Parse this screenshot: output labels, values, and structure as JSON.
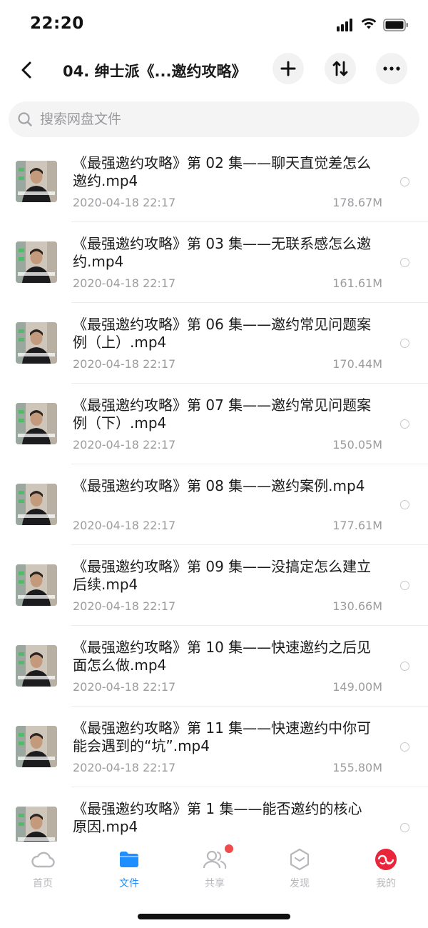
{
  "status_bar": {
    "time": "22:20"
  },
  "nav": {
    "title": "04. 绅士派《...邀约攻略》"
  },
  "search": {
    "placeholder": "搜索网盘文件"
  },
  "files": [
    {
      "name": "《最强邀约攻略》第 02 集——聊天直觉差怎么邀约.mp4",
      "date": "2020-04-18 22:17",
      "size": "178.67M"
    },
    {
      "name": "《最强邀约攻略》第 03 集——无联系感怎么邀约.mp4",
      "date": "2020-04-18 22:17",
      "size": "161.61M"
    },
    {
      "name": "《最强邀约攻略》第 06 集——邀约常见问题案例（上）.mp4",
      "date": "2020-04-18 22:17",
      "size": "170.44M"
    },
    {
      "name": "《最强邀约攻略》第 07 集——邀约常见问题案例（下）.mp4",
      "date": "2020-04-18 22:17",
      "size": "150.05M"
    },
    {
      "name": "《最强邀约攻略》第 08 集——邀约案例.mp4",
      "date": "2020-04-18 22:17",
      "size": "177.61M"
    },
    {
      "name": "《最强邀约攻略》第 09 集——没搞定怎么建立后续.mp4",
      "date": "2020-04-18 22:17",
      "size": "130.66M"
    },
    {
      "name": "《最强邀约攻略》第 10 集——快速邀约之后见面怎么做.mp4",
      "date": "2020-04-18 22:17",
      "size": "149.00M"
    },
    {
      "name": "《最强邀约攻略》第 11 集——快速邀约中你可能会遇到的“坑”.mp4",
      "date": "2020-04-18 22:17",
      "size": "155.80M"
    },
    {
      "name": "《最强邀约攻略》第 1 集——能否邀约的核心原因.mp4",
      "date": "",
      "size": ""
    }
  ],
  "tabs": [
    {
      "label": "首页",
      "icon": "cloud-icon"
    },
    {
      "label": "文件",
      "icon": "folder-icon",
      "active": true
    },
    {
      "label": "共享",
      "icon": "people-icon",
      "badge": true
    },
    {
      "label": "发现",
      "icon": "discover-icon"
    },
    {
      "label": "我的",
      "icon": "profile-icon"
    }
  ],
  "colors": {
    "accent": "#1f8fff",
    "badge": "#f04a4a",
    "profile": "#e8253a"
  }
}
